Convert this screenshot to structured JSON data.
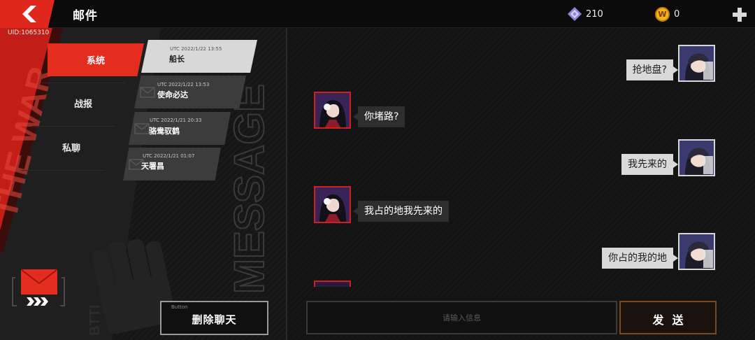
{
  "header": {
    "title": "邮件",
    "uid": "UID:1065310",
    "gems": "210",
    "coins": "0",
    "coin_symbol": "W"
  },
  "background_text": {
    "left_vertical": "THE WAR",
    "middle_vertical": "MESSAGE",
    "bottom_watermark": "BTTI"
  },
  "categories": [
    {
      "label": "系统",
      "active": true
    },
    {
      "label": "战报",
      "active": false
    },
    {
      "label": "私聊",
      "active": false
    }
  ],
  "mails": [
    {
      "time": "UTC 2022/1/22 13:55",
      "name": "船长",
      "active": true
    },
    {
      "time": "UTC 2022/1/22 13:53",
      "name": "使命必达",
      "active": false
    },
    {
      "time": "UTC 2022/1/21 20:33",
      "name": "骆鸯驭鹤",
      "active": false
    },
    {
      "time": "UTC 2022/1/21 01:07",
      "name": "天署昌",
      "active": false
    }
  ],
  "messages": [
    {
      "text": "抢地盘?",
      "from": "self"
    },
    {
      "text": "你堵路?",
      "from": "other"
    },
    {
      "text": "我先来的",
      "from": "self"
    },
    {
      "text": "我占的地我先来的",
      "from": "other"
    },
    {
      "text": "你占的我的地",
      "from": "self"
    }
  ],
  "delete_button": {
    "tag": "Button",
    "label": "删除聊天"
  },
  "input": {
    "placeholder": "请输入信息"
  },
  "send_button": {
    "label": "发送"
  },
  "colors": {
    "accent_red": "#e42c1f",
    "send_border": "#7a4a1f",
    "gem": "#8f86d8",
    "coin": "#f2b21c"
  }
}
